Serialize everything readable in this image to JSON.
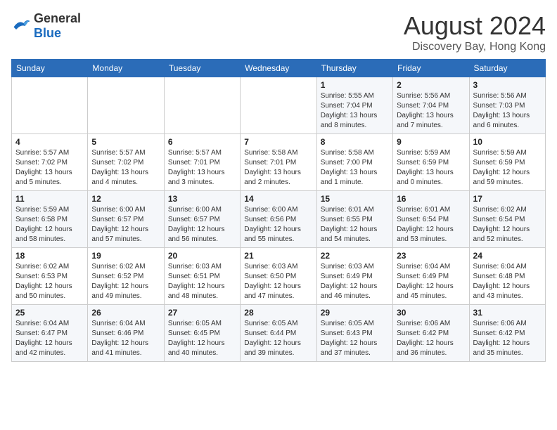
{
  "header": {
    "logo_general": "General",
    "logo_blue": "Blue",
    "month_year": "August 2024",
    "location": "Discovery Bay, Hong Kong"
  },
  "days_of_week": [
    "Sunday",
    "Monday",
    "Tuesday",
    "Wednesday",
    "Thursday",
    "Friday",
    "Saturday"
  ],
  "weeks": [
    [
      {
        "day": "",
        "info": ""
      },
      {
        "day": "",
        "info": ""
      },
      {
        "day": "",
        "info": ""
      },
      {
        "day": "",
        "info": ""
      },
      {
        "day": "1",
        "info": "Sunrise: 5:55 AM\nSunset: 7:04 PM\nDaylight: 13 hours\nand 8 minutes."
      },
      {
        "day": "2",
        "info": "Sunrise: 5:56 AM\nSunset: 7:04 PM\nDaylight: 13 hours\nand 7 minutes."
      },
      {
        "day": "3",
        "info": "Sunrise: 5:56 AM\nSunset: 7:03 PM\nDaylight: 13 hours\nand 6 minutes."
      }
    ],
    [
      {
        "day": "4",
        "info": "Sunrise: 5:57 AM\nSunset: 7:02 PM\nDaylight: 13 hours\nand 5 minutes."
      },
      {
        "day": "5",
        "info": "Sunrise: 5:57 AM\nSunset: 7:02 PM\nDaylight: 13 hours\nand 4 minutes."
      },
      {
        "day": "6",
        "info": "Sunrise: 5:57 AM\nSunset: 7:01 PM\nDaylight: 13 hours\nand 3 minutes."
      },
      {
        "day": "7",
        "info": "Sunrise: 5:58 AM\nSunset: 7:01 PM\nDaylight: 13 hours\nand 2 minutes."
      },
      {
        "day": "8",
        "info": "Sunrise: 5:58 AM\nSunset: 7:00 PM\nDaylight: 13 hours\nand 1 minute."
      },
      {
        "day": "9",
        "info": "Sunrise: 5:59 AM\nSunset: 6:59 PM\nDaylight: 13 hours\nand 0 minutes."
      },
      {
        "day": "10",
        "info": "Sunrise: 5:59 AM\nSunset: 6:59 PM\nDaylight: 12 hours\nand 59 minutes."
      }
    ],
    [
      {
        "day": "11",
        "info": "Sunrise: 5:59 AM\nSunset: 6:58 PM\nDaylight: 12 hours\nand 58 minutes."
      },
      {
        "day": "12",
        "info": "Sunrise: 6:00 AM\nSunset: 6:57 PM\nDaylight: 12 hours\nand 57 minutes."
      },
      {
        "day": "13",
        "info": "Sunrise: 6:00 AM\nSunset: 6:57 PM\nDaylight: 12 hours\nand 56 minutes."
      },
      {
        "day": "14",
        "info": "Sunrise: 6:00 AM\nSunset: 6:56 PM\nDaylight: 12 hours\nand 55 minutes."
      },
      {
        "day": "15",
        "info": "Sunrise: 6:01 AM\nSunset: 6:55 PM\nDaylight: 12 hours\nand 54 minutes."
      },
      {
        "day": "16",
        "info": "Sunrise: 6:01 AM\nSunset: 6:54 PM\nDaylight: 12 hours\nand 53 minutes."
      },
      {
        "day": "17",
        "info": "Sunrise: 6:02 AM\nSunset: 6:54 PM\nDaylight: 12 hours\nand 52 minutes."
      }
    ],
    [
      {
        "day": "18",
        "info": "Sunrise: 6:02 AM\nSunset: 6:53 PM\nDaylight: 12 hours\nand 50 minutes."
      },
      {
        "day": "19",
        "info": "Sunrise: 6:02 AM\nSunset: 6:52 PM\nDaylight: 12 hours\nand 49 minutes."
      },
      {
        "day": "20",
        "info": "Sunrise: 6:03 AM\nSunset: 6:51 PM\nDaylight: 12 hours\nand 48 minutes."
      },
      {
        "day": "21",
        "info": "Sunrise: 6:03 AM\nSunset: 6:50 PM\nDaylight: 12 hours\nand 47 minutes."
      },
      {
        "day": "22",
        "info": "Sunrise: 6:03 AM\nSunset: 6:49 PM\nDaylight: 12 hours\nand 46 minutes."
      },
      {
        "day": "23",
        "info": "Sunrise: 6:04 AM\nSunset: 6:49 PM\nDaylight: 12 hours\nand 45 minutes."
      },
      {
        "day": "24",
        "info": "Sunrise: 6:04 AM\nSunset: 6:48 PM\nDaylight: 12 hours\nand 43 minutes."
      }
    ],
    [
      {
        "day": "25",
        "info": "Sunrise: 6:04 AM\nSunset: 6:47 PM\nDaylight: 12 hours\nand 42 minutes."
      },
      {
        "day": "26",
        "info": "Sunrise: 6:04 AM\nSunset: 6:46 PM\nDaylight: 12 hours\nand 41 minutes."
      },
      {
        "day": "27",
        "info": "Sunrise: 6:05 AM\nSunset: 6:45 PM\nDaylight: 12 hours\nand 40 minutes."
      },
      {
        "day": "28",
        "info": "Sunrise: 6:05 AM\nSunset: 6:44 PM\nDaylight: 12 hours\nand 39 minutes."
      },
      {
        "day": "29",
        "info": "Sunrise: 6:05 AM\nSunset: 6:43 PM\nDaylight: 12 hours\nand 37 minutes."
      },
      {
        "day": "30",
        "info": "Sunrise: 6:06 AM\nSunset: 6:42 PM\nDaylight: 12 hours\nand 36 minutes."
      },
      {
        "day": "31",
        "info": "Sunrise: 6:06 AM\nSunset: 6:42 PM\nDaylight: 12 hours\nand 35 minutes."
      }
    ]
  ]
}
